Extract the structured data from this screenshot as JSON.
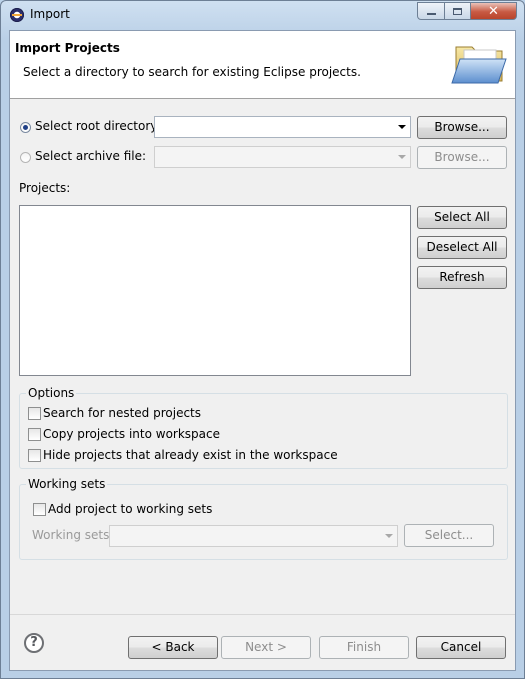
{
  "window": {
    "title": "Import"
  },
  "header": {
    "title": "Import Projects",
    "subtitle": "Select a directory to search for existing Eclipse projects."
  },
  "source": {
    "root_directory_label": "Select root directory:",
    "root_directory_value": "",
    "archive_file_label": "Select archive file:",
    "archive_file_value": "",
    "browse_label": "Browse...",
    "selected": "root_directory"
  },
  "projects": {
    "label": "Projects:",
    "items": [],
    "select_all": "Select All",
    "deselect_all": "Deselect All",
    "refresh": "Refresh"
  },
  "options": {
    "title": "Options",
    "items": [
      {
        "label": "Search for nested projects",
        "checked": false
      },
      {
        "label": "Copy projects into workspace",
        "checked": false
      },
      {
        "label": "Hide projects that already exist in the workspace",
        "checked": false
      }
    ]
  },
  "working_sets": {
    "title": "Working sets",
    "add_label": "Add project to working sets",
    "add_checked": false,
    "field_label": "Working sets:",
    "field_value": "",
    "select_label": "Select..."
  },
  "footer": {
    "back": "< Back",
    "next": "Next >",
    "finish": "Finish",
    "cancel": "Cancel"
  },
  "icons": {
    "app": "eclipse-icon",
    "header": "open-folder-icon",
    "help": "help-icon"
  }
}
